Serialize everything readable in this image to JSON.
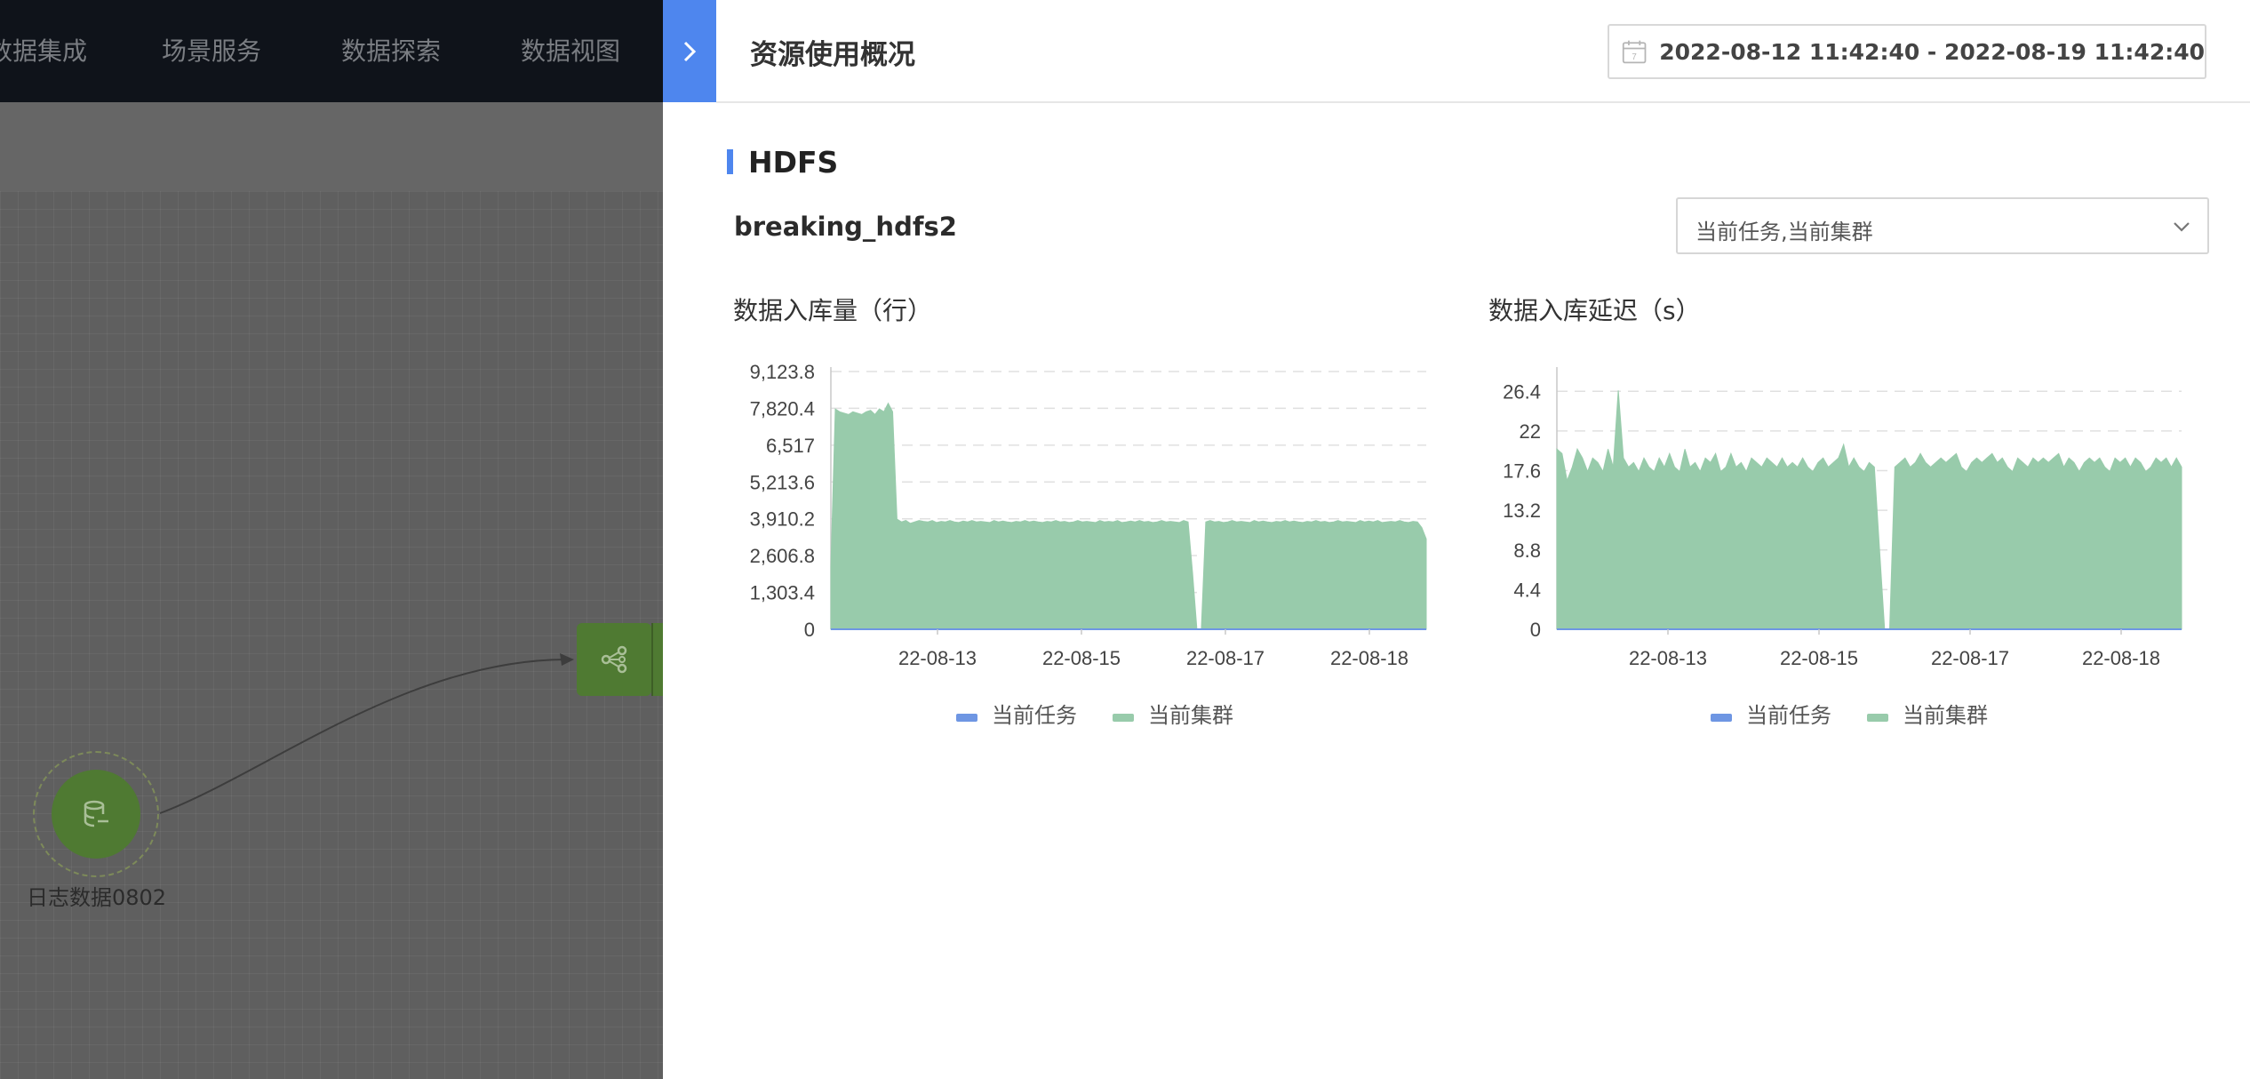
{
  "nav": {
    "items": [
      "数据集成",
      "场景服务",
      "数据探索",
      "数据视图"
    ]
  },
  "canvas": {
    "source_node": {
      "label": "日志数据0802",
      "icon": "database-icon"
    },
    "process_node": {
      "icon": "share-nodes-icon"
    }
  },
  "drawer": {
    "toggle_icon": "chevron-right-icon",
    "title": "资源使用概况",
    "date_range": "2022-08-12 11:42:40 - 2022-08-19 11:42:40",
    "section_title": "HDFS",
    "hdfs_name": "breaking_hdfs2",
    "select_value": "当前任务,当前集群"
  },
  "colors": {
    "accent": "#4e86ee",
    "series_task": "#6e96e3",
    "series_cluster": "#98cbab"
  },
  "chart_data": [
    {
      "type": "area",
      "title": "数据入库量（行）",
      "x_ticks": [
        "22-08-13",
        "22-08-15",
        "22-08-17",
        "22-08-18"
      ],
      "y_ticks": [
        "0",
        "1,303.4",
        "2,606.8",
        "3,910.2",
        "5,213.6",
        "6,517",
        "7,820.4",
        "9,123.8"
      ],
      "ylim": [
        0,
        9123.8
      ],
      "grid": true,
      "legend": "bottom",
      "series": [
        {
          "name": "当前任务",
          "color": "#6e96e3",
          "values": []
        },
        {
          "name": "当前集群",
          "color": "#98cbab",
          "values": [
            2200,
            7800,
            7700,
            7650,
            7600,
            7700,
            7650,
            7600,
            7700,
            7750,
            7600,
            7800,
            7700,
            8000,
            7700,
            3900,
            3800,
            3850,
            3750,
            3800,
            3850,
            3820,
            3800,
            3850,
            3780,
            3820,
            3800,
            3850,
            3800,
            3780,
            3830,
            3800,
            3850,
            3800,
            3820,
            3800,
            3780,
            3850,
            3800,
            3830,
            3800,
            3780,
            3820,
            3800,
            3850,
            3800,
            3830,
            3800,
            3780,
            3820,
            3800,
            3850,
            3800,
            3820,
            3780,
            3800,
            3850,
            3800,
            3820,
            3800,
            3780,
            3850,
            3800,
            3820,
            3800,
            3850,
            3780,
            3800,
            3830,
            3800,
            3850,
            3800,
            3820,
            3780,
            3800,
            3850,
            3800,
            3820,
            3800,
            3780,
            3850,
            3800,
            2000,
            0,
            0,
            3800,
            3850,
            3800,
            3820,
            3780,
            3800,
            3850,
            3800,
            3820,
            3800,
            3780,
            3850,
            3800,
            3830,
            3800,
            3780,
            3820,
            3800,
            3850,
            3800,
            3830,
            3800,
            3780,
            3820,
            3800,
            3850,
            3800,
            3820,
            3780,
            3800,
            3850,
            3800,
            3820,
            3800,
            3780,
            3850,
            3800,
            3830,
            3800,
            3850,
            3780,
            3800,
            3820,
            3800,
            3850,
            3800,
            3780,
            3820,
            3800,
            3600,
            3200
          ]
        }
      ]
    },
    {
      "type": "area",
      "title": "数据入库延迟（s）",
      "x_ticks": [
        "22-08-13",
        "22-08-15",
        "22-08-17",
        "22-08-18"
      ],
      "y_ticks": [
        "0",
        "4.4",
        "8.8",
        "13.2",
        "17.6",
        "22",
        "26.4"
      ],
      "ylim": [
        0,
        28.6
      ],
      "grid": true,
      "legend": "bottom",
      "series": [
        {
          "name": "当前任务",
          "color": "#6e96e3",
          "values": []
        },
        {
          "name": "当前集群",
          "color": "#98cbab",
          "values": [
            20,
            19.5,
            16.5,
            18,
            20,
            19,
            17.5,
            19,
            18.5,
            17.5,
            20,
            18,
            26.5,
            19,
            18,
            18.5,
            17.5,
            19,
            18,
            17.5,
            19,
            18,
            19.5,
            18,
            17.5,
            20,
            18,
            18.5,
            17.5,
            19,
            18.5,
            19.5,
            17.5,
            18,
            19.5,
            18,
            18.5,
            17.5,
            19,
            18.5,
            18,
            19,
            18.5,
            18,
            19,
            18,
            18.5,
            18,
            19,
            18,
            17.5,
            18.5,
            19,
            18,
            18.5,
            19,
            20.5,
            18,
            19,
            18,
            17.5,
            18.5,
            18,
            9,
            0,
            0,
            18,
            18.5,
            19,
            18,
            18.5,
            19.5,
            18.5,
            18,
            18.5,
            19,
            18.5,
            19,
            19.5,
            18,
            17.5,
            18.5,
            19,
            18.5,
            19,
            19.5,
            18.5,
            19,
            18,
            17.5,
            19,
            18.5,
            18,
            19,
            18.5,
            19,
            18.5,
            19,
            19.5,
            18,
            19,
            18.5,
            17.5,
            18.5,
            19,
            18.5,
            19,
            18,
            17.5,
            19,
            18.5,
            19,
            18,
            19,
            18.5,
            17.5,
            18,
            19,
            18.5,
            19,
            18,
            19,
            18
          ]
        }
      ]
    }
  ]
}
